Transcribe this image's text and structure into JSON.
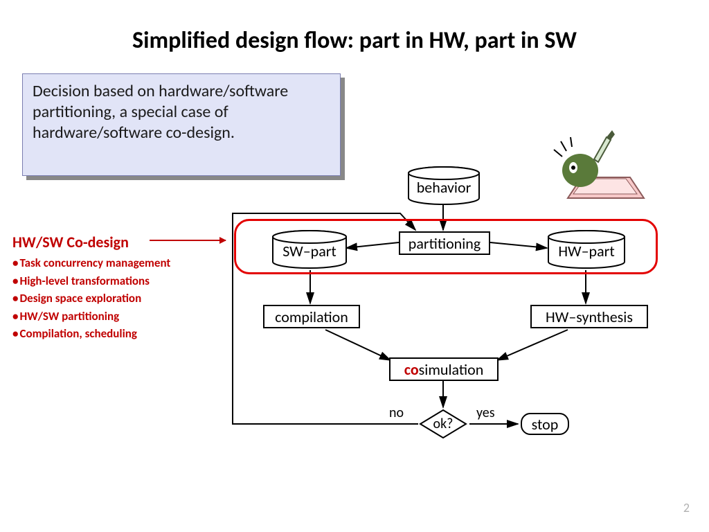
{
  "title": "Simplified design flow: part in HW, part in SW",
  "callout": "Decision based on hardware/software partitioning, a special case of hardware/software co-design.",
  "codesign": {
    "heading": "HW/SW Co-design",
    "items": [
      "Task concurrency management",
      "High-level transformations",
      "Design space exploration",
      "HW/SW partitioning",
      "Compilation, scheduling"
    ]
  },
  "flow": {
    "behavior": "behavior",
    "partitioning": "partitioning",
    "sw_part": "SW–part",
    "hw_part": "HW–part",
    "compilation": "compilation",
    "hw_synthesis": "HW–synthesis",
    "co_prefix": "co",
    "simulation": "simulation",
    "ok": "ok?",
    "no": "no",
    "yes": "yes",
    "stop": "stop"
  },
  "page": "2"
}
